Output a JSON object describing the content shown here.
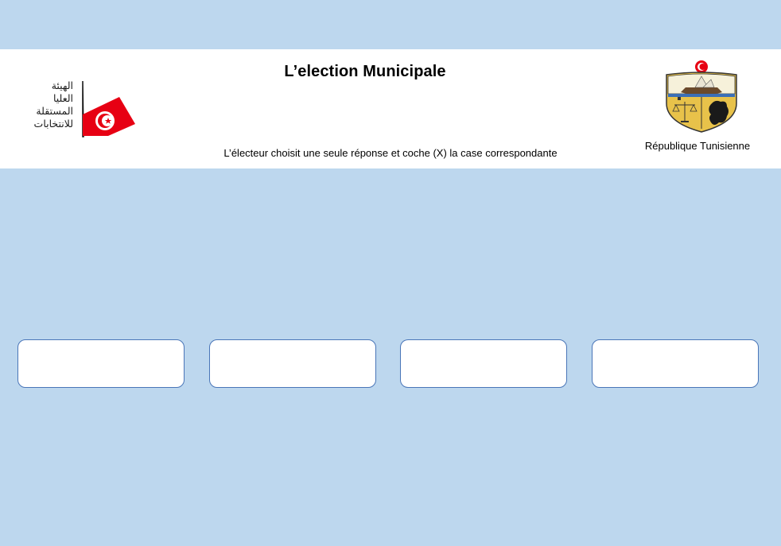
{
  "header": {
    "title": "L’election Municipale",
    "instruction": "L’électeur choisit une seule réponse et coche (X) la case correspondante",
    "country_label": "République Tunisienne",
    "isie_logo_lines": [
      "الهيئة",
      "العليا",
      "المستقلة",
      "للانتخابات"
    ]
  },
  "choices": [
    {
      "label": ""
    },
    {
      "label": ""
    },
    {
      "label": ""
    },
    {
      "label": ""
    }
  ],
  "icons": {
    "isie_logo": "isie-logo-icon",
    "coat_of_arms": "tunisia-coat-of-arms-icon"
  },
  "colors": {
    "background": "#BDD7EE",
    "header_background": "#FFFFFF",
    "choice_border": "#4A76B8",
    "flag_red": "#E70013",
    "arms_gold": "#E8C24A"
  }
}
